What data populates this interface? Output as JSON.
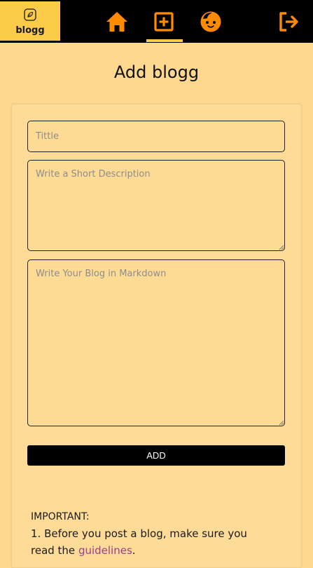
{
  "nav": {
    "logo_text": "blogg",
    "icons": {
      "home": "home-icon",
      "add": "add-square-icon",
      "profile": "face-icon",
      "logout": "logout-icon"
    },
    "colors": {
      "bar": "#000000",
      "accent": "#ff8c00",
      "logo_bg": "#fccb47"
    }
  },
  "page": {
    "title": "Add blogg"
  },
  "form": {
    "title_placeholder": "Tittle",
    "description_placeholder": "Write a Short Description",
    "body_placeholder": "Write Your Blog in Markdown",
    "submit_label": "ADD"
  },
  "notice": {
    "heading": "IMPORTANT:",
    "line1_prefix": "1. Before you post a blog, make sure you",
    "line2_prefix": "read the ",
    "link_text": "guidelines",
    "line2_suffix": "."
  }
}
